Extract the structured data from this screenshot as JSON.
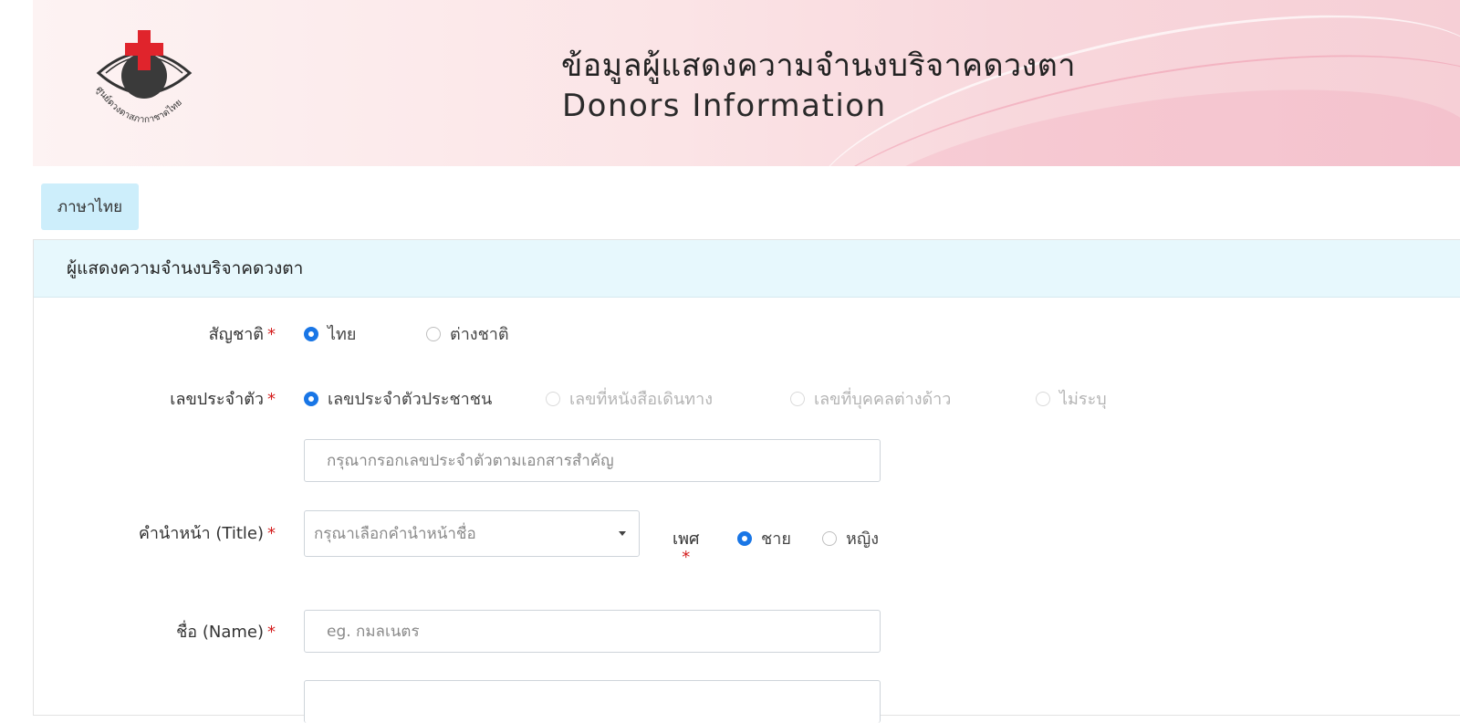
{
  "header": {
    "logo_text": "ศูนย์ดวงตาสภากาชาดไทย",
    "title_th": "ข้อมูลผู้แสดงความจำนงบริจาคดวงตา",
    "title_en": "Donors Information"
  },
  "language_button": "ภาษาไทย",
  "card": {
    "title": "ผู้แสดงความจำนงบริจาคดวงตา"
  },
  "form": {
    "nationality": {
      "label": "สัญชาติ",
      "required": "*",
      "options": [
        {
          "label": "ไทย",
          "checked": true
        },
        {
          "label": "ต่างชาติ",
          "checked": false
        }
      ]
    },
    "id_type": {
      "label": "เลขประจำตัว",
      "required": "*",
      "options": [
        {
          "label": "เลขประจำตัวประชาชน",
          "checked": true,
          "disabled": false
        },
        {
          "label": "เลขที่หนังสือเดินทาง",
          "checked": false,
          "disabled": true
        },
        {
          "label": "เลขที่บุคคลต่างด้าว",
          "checked": false,
          "disabled": true
        },
        {
          "label": "ไม่ระบุ",
          "checked": false,
          "disabled": true
        }
      ]
    },
    "id_number": {
      "placeholder": "กรุณากรอกเลขประจำตัวตามเอกสารสำคัญ",
      "value": ""
    },
    "title_field": {
      "label": "คำนำหน้า (Title)",
      "required": "*",
      "placeholder": "กรุณาเลือกคำนำหน้าชื่อ"
    },
    "gender": {
      "label": "เพศ",
      "required": "*",
      "options": [
        {
          "label": "ชาย",
          "checked": true
        },
        {
          "label": "หญิง",
          "checked": false
        }
      ]
    },
    "name": {
      "label": "ชื่อ (Name)",
      "required": "*",
      "placeholder": "eg. กมลเนตร",
      "value": ""
    }
  },
  "colors": {
    "accent": "#1976e6",
    "required": "#d41d1d",
    "card_header_bg": "#e7f8fd",
    "lang_button_bg": "#cdeefb",
    "logo_cross": "#e0242c"
  }
}
